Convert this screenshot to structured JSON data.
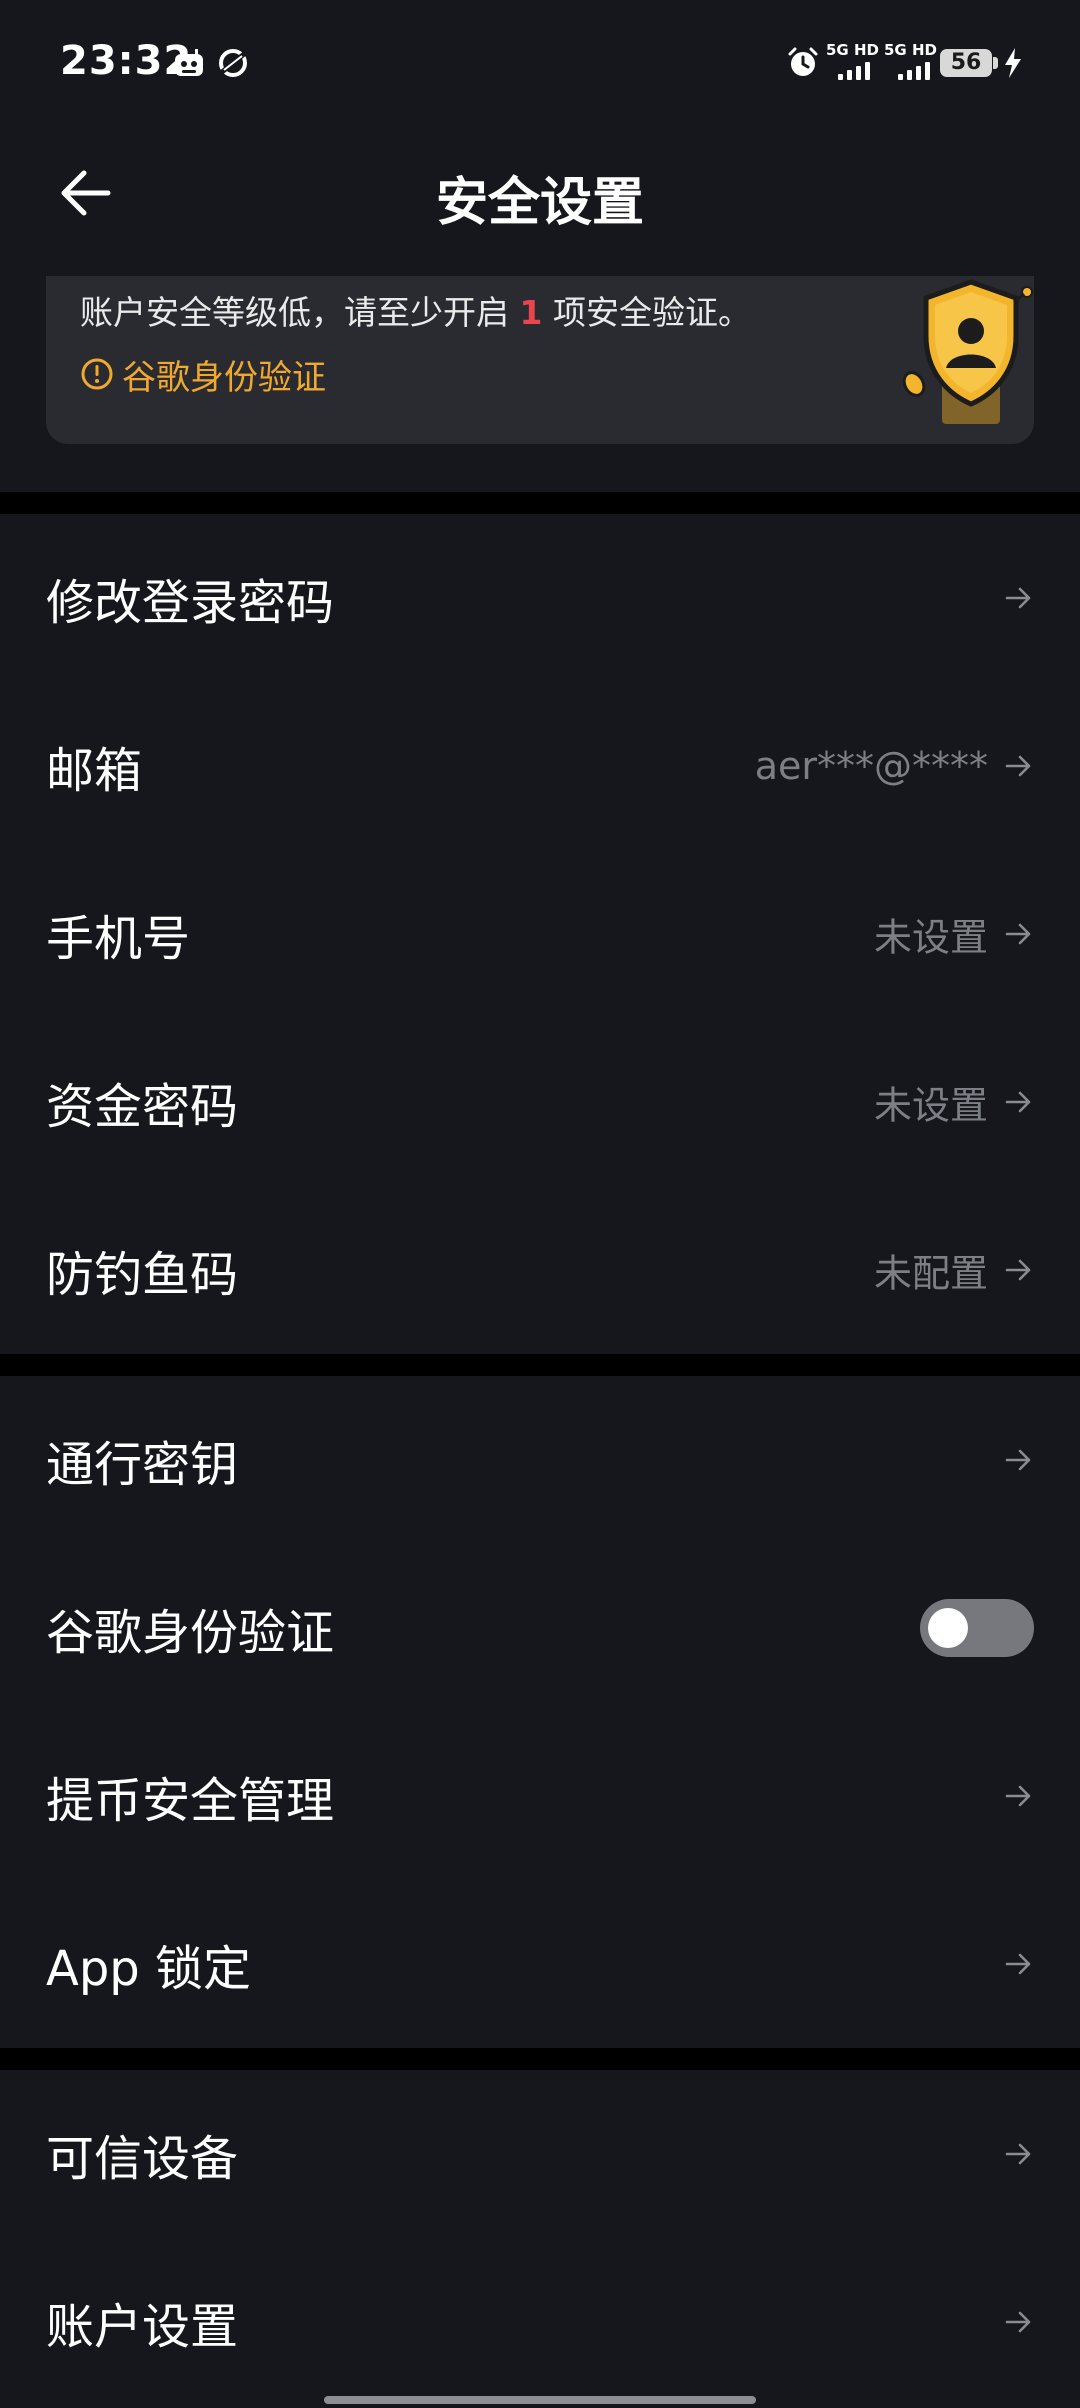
{
  "status_bar": {
    "time": "23:32",
    "network_1": "5G HD",
    "network_2": "5G HD",
    "battery": "56",
    "icons": [
      "notification-app-icon",
      "notification-app-icon-2",
      "alarm-icon",
      "signal-icon",
      "charging-icon"
    ]
  },
  "header": {
    "title": "安全设置",
    "back_icon": "arrow-left-icon"
  },
  "security_card": {
    "warning_prefix": "账户安全等级低，请至少开启",
    "warning_count": "1",
    "warning_suffix": "项安全验证。",
    "pending_item": "谷歌身份验证",
    "colors": {
      "warning_count": "#e8454f",
      "pending_item": "#f0a92e"
    }
  },
  "section1": [
    {
      "label": "修改登录密码",
      "value": ""
    },
    {
      "label": "邮箱",
      "value": "aer***@****"
    },
    {
      "label": "手机号",
      "value": "未设置"
    },
    {
      "label": "资金密码",
      "value": "未设置"
    },
    {
      "label": "防钓鱼码",
      "value": "未配置"
    }
  ],
  "section2": [
    {
      "label": "通行密钥"
    },
    {
      "label": "谷歌身份验证",
      "toggle": false
    },
    {
      "label": "提币安全管理"
    },
    {
      "label": "App 锁定"
    }
  ],
  "section3": [
    {
      "label": "可信设备"
    },
    {
      "label": "账户设置"
    }
  ],
  "row_icon": "arrow-right-icon"
}
